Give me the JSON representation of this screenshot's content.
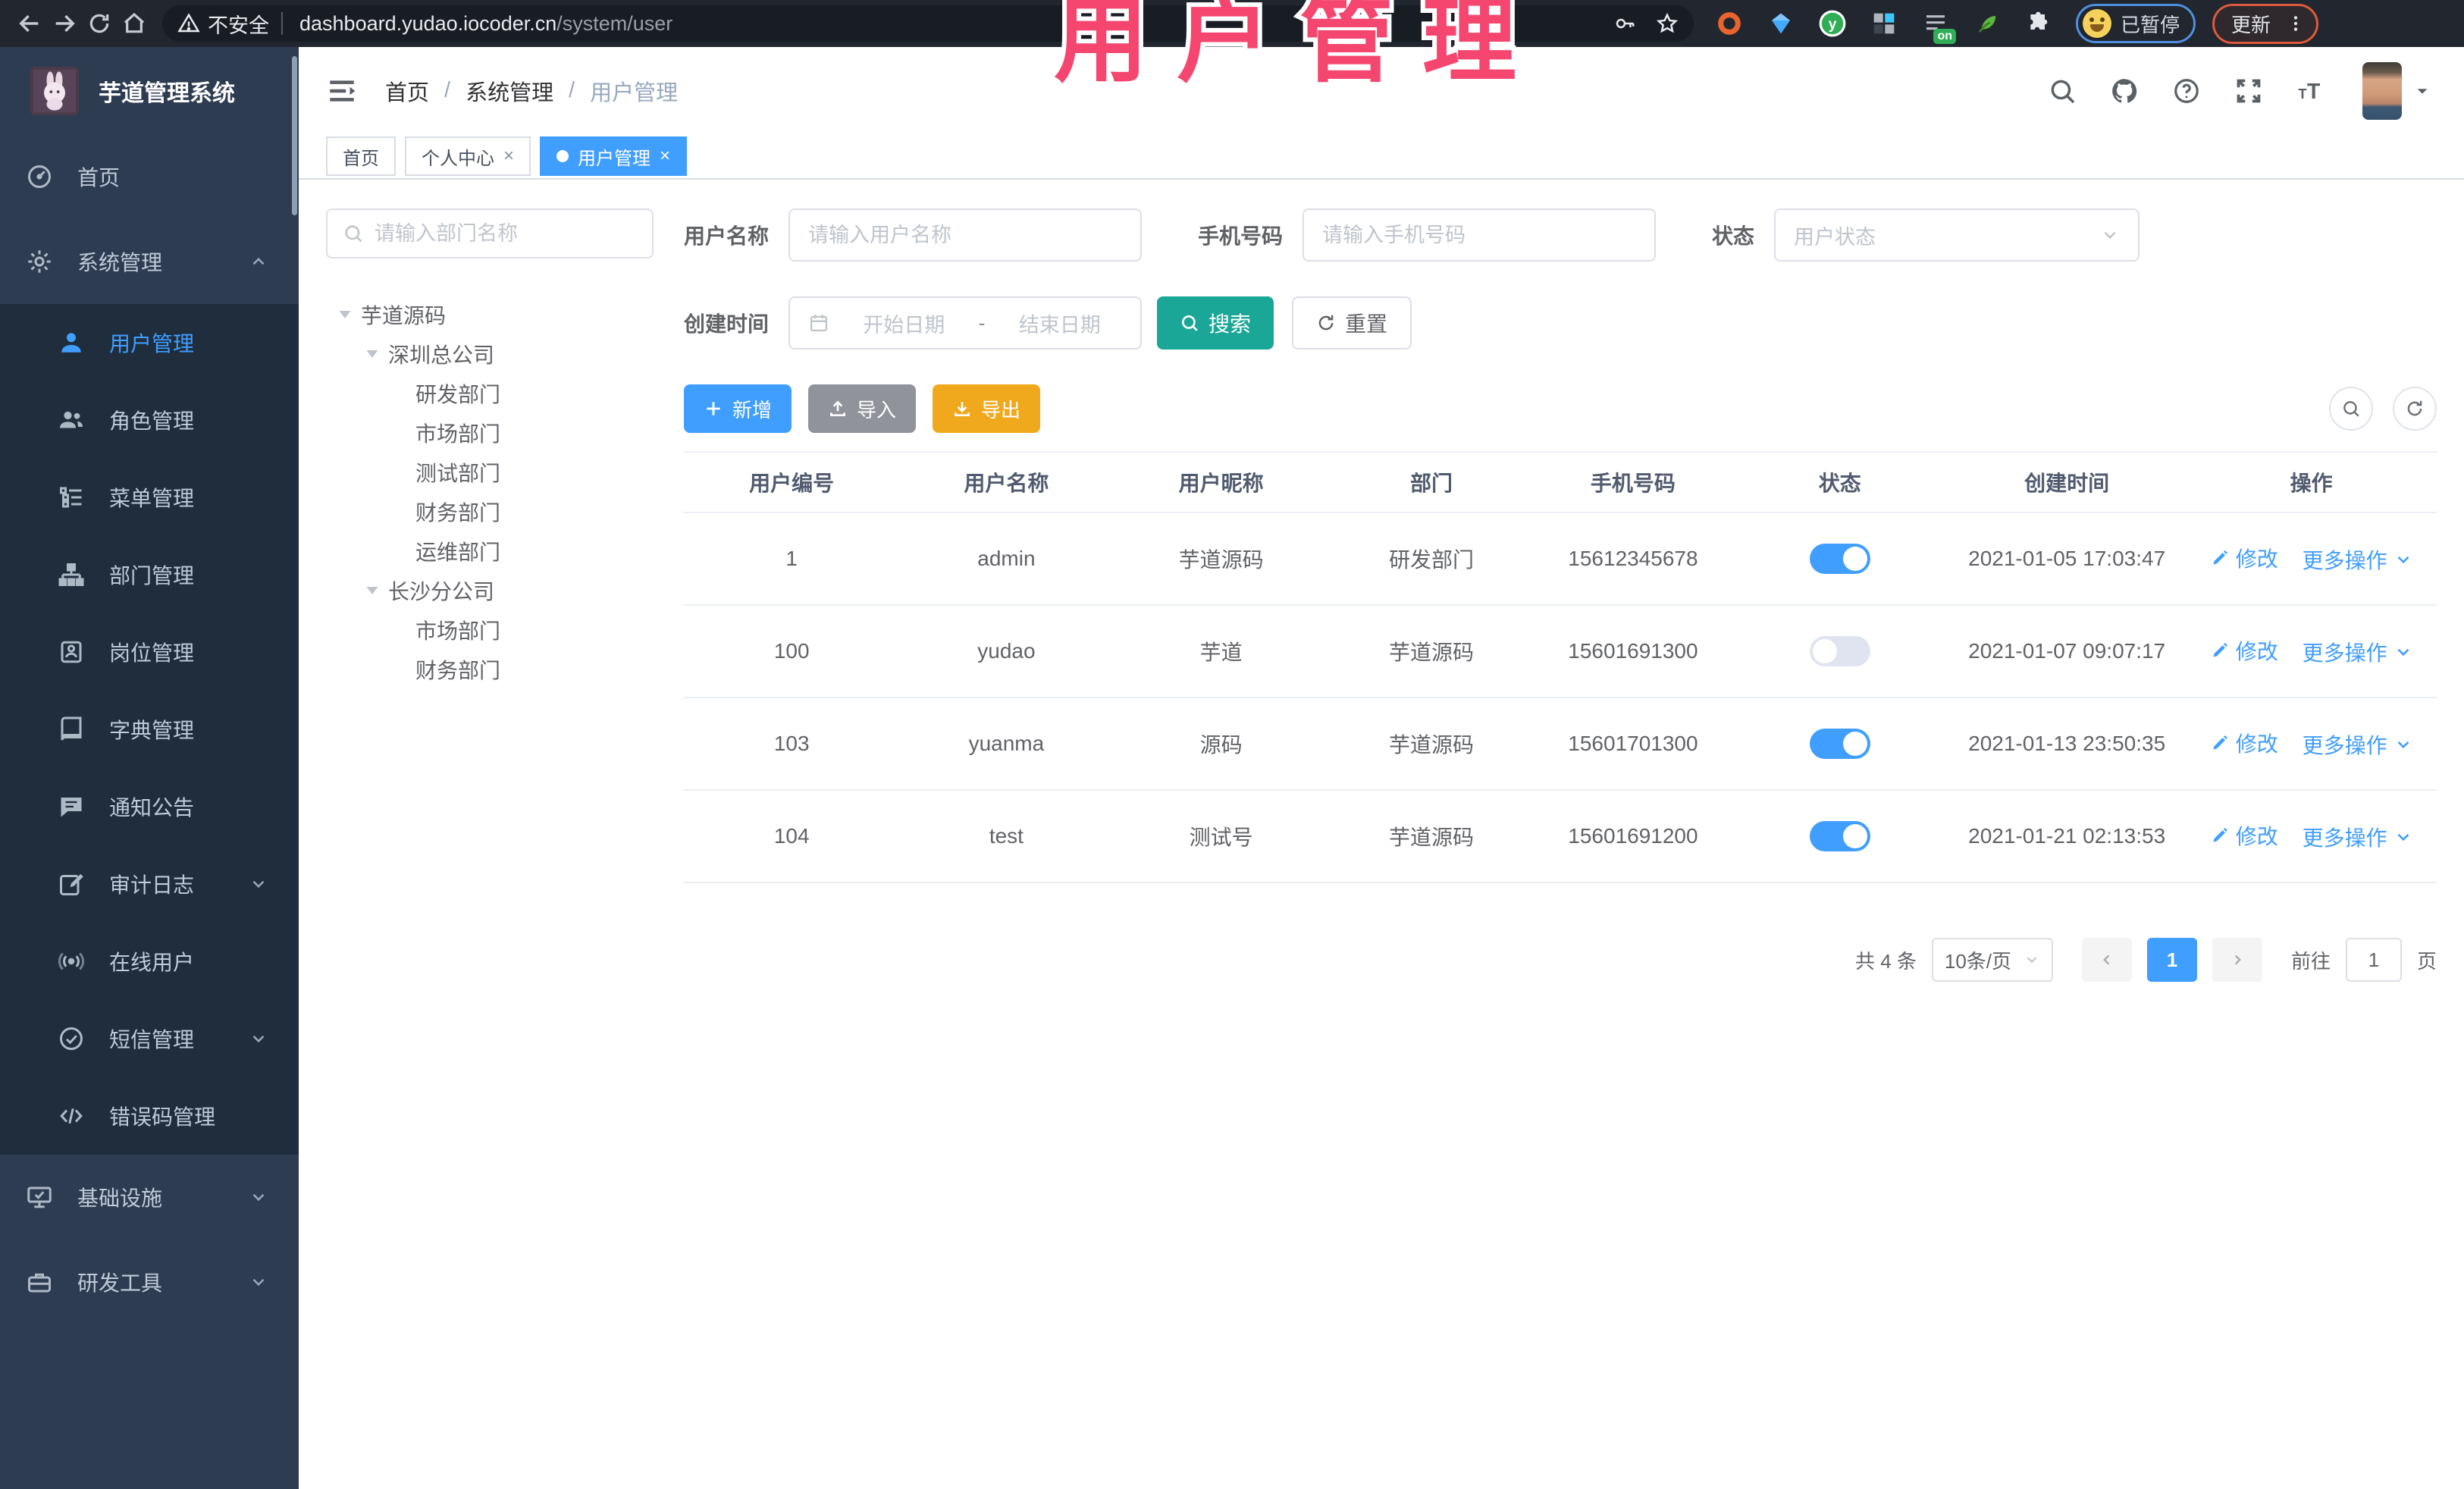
{
  "browser": {
    "security_label": "不安全",
    "url_host": "dashboard.yudao.iocoder.cn",
    "url_path": "/system/user",
    "extension_on_badge": "on",
    "paused_badge": "已暂停",
    "update_label": "更新"
  },
  "overlay_title": "用户管理",
  "sidebar": {
    "logo_title": "芋道管理系统",
    "items": [
      {
        "label": "首页"
      },
      {
        "label": "系统管理"
      },
      {
        "label": "用户管理"
      },
      {
        "label": "角色管理"
      },
      {
        "label": "菜单管理"
      },
      {
        "label": "部门管理"
      },
      {
        "label": "岗位管理"
      },
      {
        "label": "字典管理"
      },
      {
        "label": "通知公告"
      },
      {
        "label": "审计日志"
      },
      {
        "label": "在线用户"
      },
      {
        "label": "短信管理"
      },
      {
        "label": "错误码管理"
      },
      {
        "label": "基础设施"
      },
      {
        "label": "研发工具"
      }
    ]
  },
  "header": {
    "breadcrumb": [
      "首页",
      "系统管理",
      "用户管理"
    ]
  },
  "tabs": [
    {
      "label": "首页"
    },
    {
      "label": "个人中心"
    },
    {
      "label": "用户管理"
    }
  ],
  "tree": {
    "search_placeholder": "请输入部门名称",
    "nodes": [
      {
        "label": "芋道源码"
      },
      {
        "label": "深圳总公司"
      },
      {
        "label": "研发部门"
      },
      {
        "label": "市场部门"
      },
      {
        "label": "测试部门"
      },
      {
        "label": "财务部门"
      },
      {
        "label": "运维部门"
      },
      {
        "label": "长沙分公司"
      },
      {
        "label": "市场部门"
      },
      {
        "label": "财务部门"
      }
    ]
  },
  "filters": {
    "username_label": "用户名称",
    "username_placeholder": "请输入用户名称",
    "mobile_label": "手机号码",
    "mobile_placeholder": "请输入手机号码",
    "status_label": "状态",
    "status_placeholder": "用户状态",
    "created_label": "创建时间",
    "date_start_placeholder": "开始日期",
    "date_separator": "-",
    "date_end_placeholder": "结束日期",
    "search_label": "搜索",
    "reset_label": "重置"
  },
  "toolbar": {
    "add_label": "新增",
    "import_label": "导入",
    "export_label": "导出"
  },
  "table": {
    "headers": [
      "用户编号",
      "用户名称",
      "用户昵称",
      "部门",
      "手机号码",
      "状态",
      "创建时间",
      "操作"
    ],
    "edit_label": "修改",
    "more_label": "更多操作",
    "rows": [
      {
        "id": "1",
        "username": "admin",
        "nickname": "芋道源码",
        "dept": "研发部门",
        "mobile": "15612345678",
        "status": "on",
        "created": "2021-01-05 17:03:47"
      },
      {
        "id": "100",
        "username": "yudao",
        "nickname": "芋道",
        "dept": "芋道源码",
        "mobile": "15601691300",
        "status": "off",
        "created": "2021-01-07 09:07:17"
      },
      {
        "id": "103",
        "username": "yuanma",
        "nickname": "源码",
        "dept": "芋道源码",
        "mobile": "15601701300",
        "status": "on",
        "created": "2021-01-13 23:50:35"
      },
      {
        "id": "104",
        "username": "test",
        "nickname": "测试号",
        "dept": "芋道源码",
        "mobile": "15601691200",
        "status": "on",
        "created": "2021-01-21 02:13:53"
      }
    ]
  },
  "pagination": {
    "total_label": "共 4 条",
    "page_size_label": "10条/页",
    "current_page": "1",
    "goto_label": "前往",
    "goto_value": "1",
    "page_unit": "页"
  },
  "colors": {
    "accent_blue": "#409eff",
    "search_teal": "#1aa797",
    "export_amber": "#f0a91d",
    "import_gray": "#909399",
    "overlay_pink": "#f4466f",
    "sidebar_bg": "#2e3c52",
    "submenu_bg": "#1f2d3d"
  }
}
